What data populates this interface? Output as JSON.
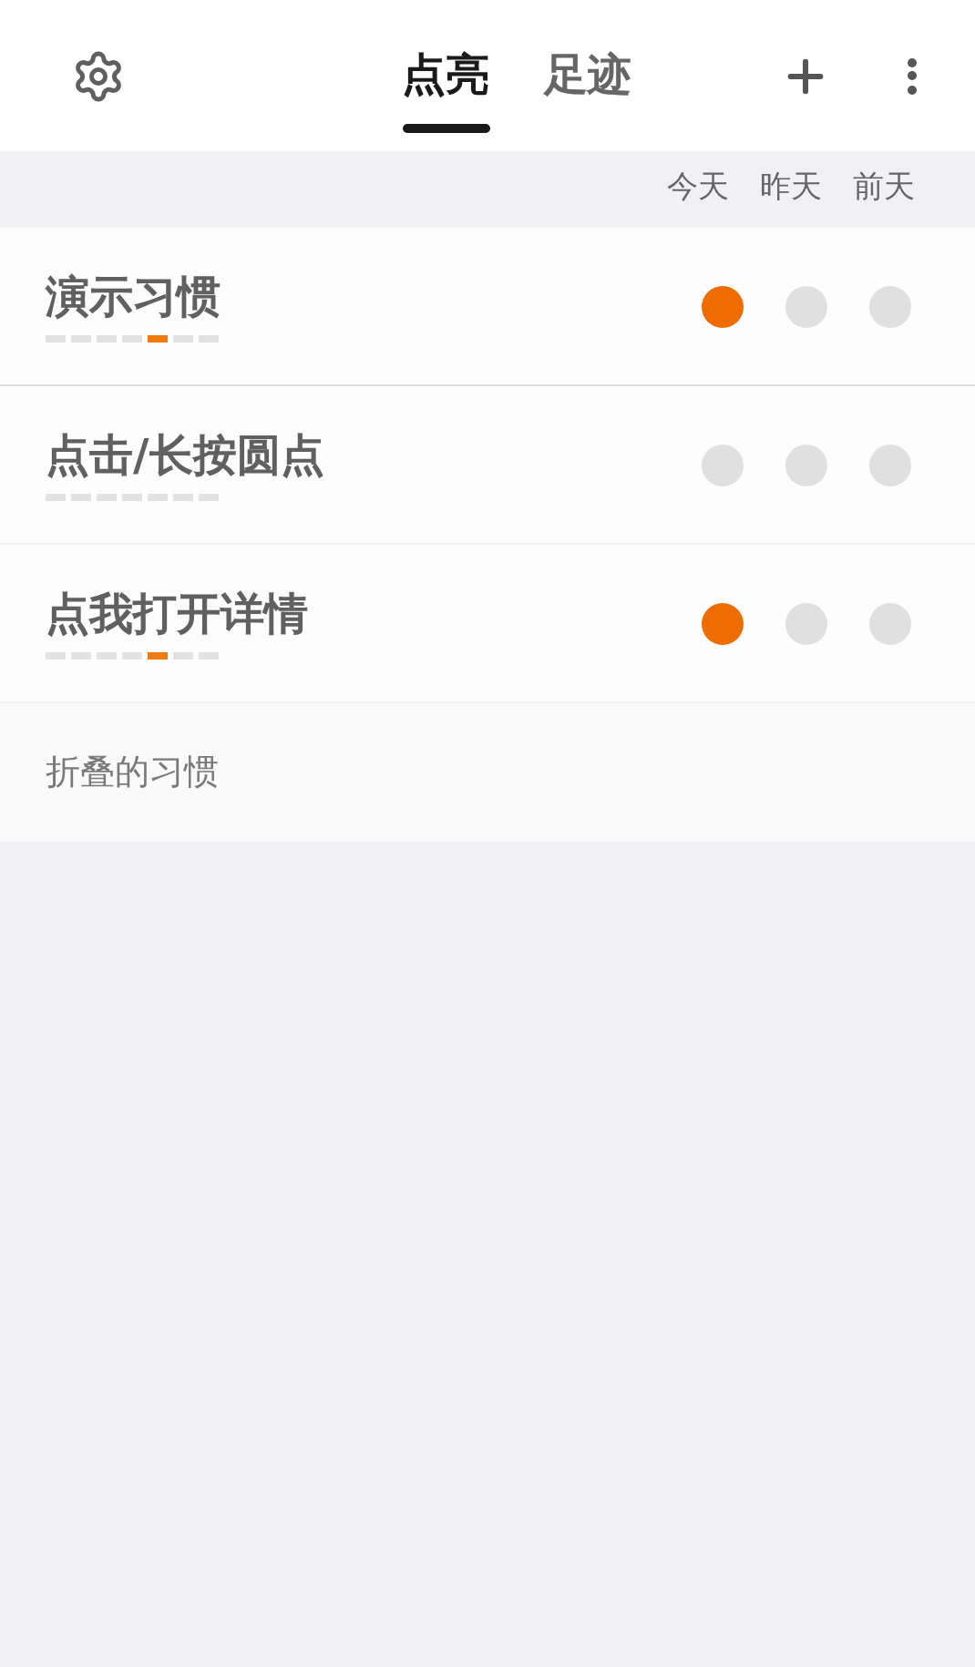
{
  "tabs": [
    {
      "label": "点亮",
      "selected": true
    },
    {
      "label": "足迹",
      "selected": false
    }
  ],
  "day_headers": [
    "今天",
    "昨天",
    "前天"
  ],
  "habits": [
    {
      "name": "演示习惯",
      "week": [
        {
          "on": false
        },
        {
          "on": false
        },
        {
          "on": false
        },
        {
          "on": false
        },
        {
          "on": true
        },
        {
          "on": false
        },
        {
          "on": false
        }
      ],
      "days": [
        {
          "on": true
        },
        {
          "on": false
        },
        {
          "on": false
        }
      ]
    },
    {
      "name": "点击/长按圆点",
      "week": [
        {
          "on": false
        },
        {
          "on": false
        },
        {
          "on": false
        },
        {
          "on": false
        },
        {
          "on": false
        },
        {
          "on": false
        },
        {
          "on": false
        }
      ],
      "days": [
        {
          "on": false
        },
        {
          "on": false
        },
        {
          "on": false
        }
      ]
    },
    {
      "name": "点我打开详情",
      "week": [
        {
          "on": false
        },
        {
          "on": false
        },
        {
          "on": false
        },
        {
          "on": false
        },
        {
          "on": true
        },
        {
          "on": false
        },
        {
          "on": false
        }
      ],
      "days": [
        {
          "on": true
        },
        {
          "on": false
        },
        {
          "on": false
        }
      ]
    }
  ],
  "folded_label": "折叠的习惯"
}
